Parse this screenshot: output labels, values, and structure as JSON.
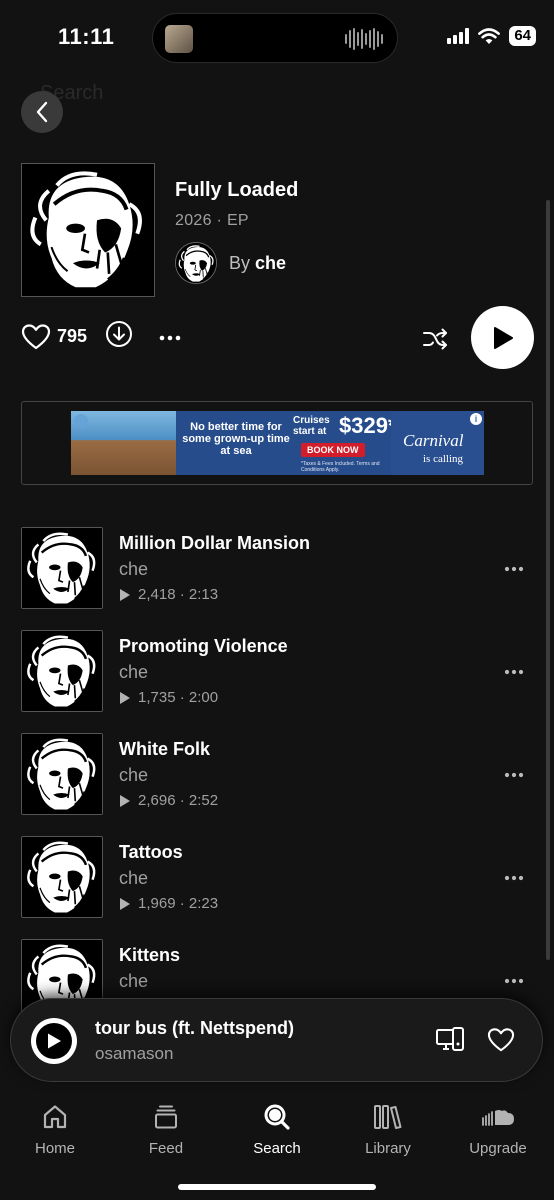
{
  "status_bar": {
    "time": "11:11",
    "battery": "64"
  },
  "header": {
    "search_placeholder": "Search"
  },
  "album": {
    "title": "Fully Loaded",
    "year": "2026",
    "separator": "·",
    "kind": "EP",
    "by_label": "By",
    "artist": "che"
  },
  "actions": {
    "like_count": "795"
  },
  "ad": {
    "headline": "No better time for some grown-up time at sea",
    "offer_line": "Cruises start at",
    "price": "$329*",
    "cta": "BOOK NOW",
    "fine_print": "*Taxes & Fees Included. Terms and Conditions Apply.",
    "brand": "Carnival",
    "tagline": "is calling"
  },
  "tracks": [
    {
      "title": "Million Dollar Mansion",
      "artist": "che",
      "plays": "2,418",
      "duration": "2:13"
    },
    {
      "title": "Promoting Violence",
      "artist": "che",
      "plays": "1,735",
      "duration": "2:00"
    },
    {
      "title": "White Folk",
      "artist": "che",
      "plays": "2,696",
      "duration": "2:52"
    },
    {
      "title": "Tattoos",
      "artist": "che",
      "plays": "1,969",
      "duration": "2:23"
    },
    {
      "title": "Kittens",
      "artist": "che",
      "plays": "",
      "duration": ""
    }
  ],
  "now_playing": {
    "title": "tour bus (ft. Nettspend)",
    "artist": "osamason"
  },
  "tabs": [
    {
      "label": "Home",
      "icon": "home-icon"
    },
    {
      "label": "Feed",
      "icon": "feed-icon"
    },
    {
      "label": "Search",
      "icon": "search-icon",
      "active": true
    },
    {
      "label": "Library",
      "icon": "library-icon"
    },
    {
      "label": "Upgrade",
      "icon": "soundcloud-icon"
    }
  ]
}
